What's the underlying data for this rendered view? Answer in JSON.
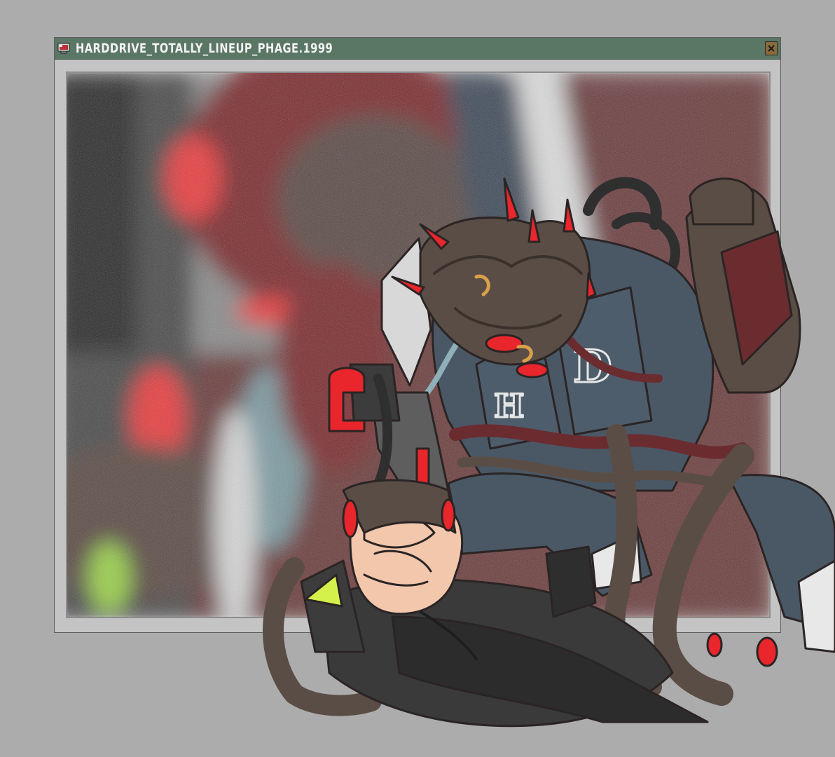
{
  "window": {
    "title": "HARDDRIVE_TOTALLY_LINEUP_PHAGE.1999",
    "icon": "app-computer-icon",
    "close_icon": "close-x-icon"
  },
  "colors": {
    "desktop": "#acacac",
    "titlebar": "#5a7664",
    "window_frame": "#c4c4c4",
    "accent_red": "#e8262b",
    "armor_blue": "#4a5a68",
    "flesh_brown": "#5a4d45"
  },
  "artwork": {
    "jersey_letters": [
      "H",
      "D"
    ]
  }
}
